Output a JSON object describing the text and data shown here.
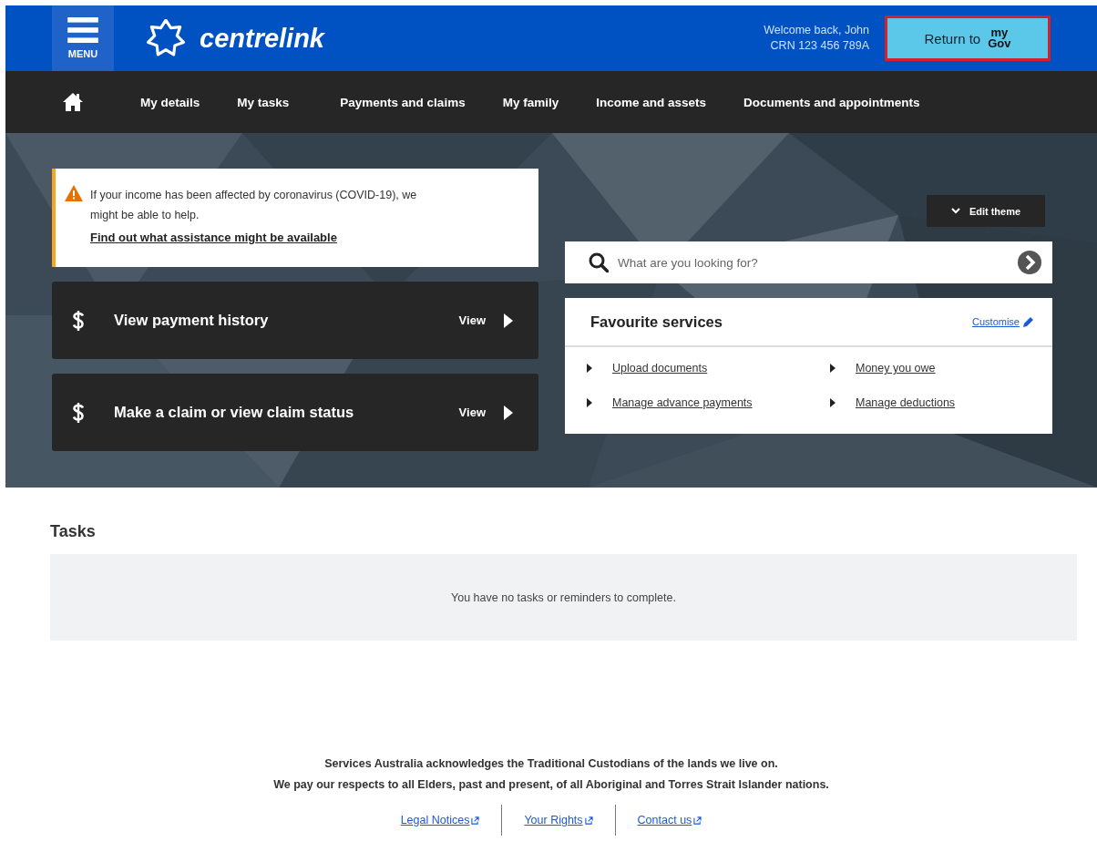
{
  "header": {
    "menu_label": "MENU",
    "brand": "centrelink",
    "welcome": "Welcome back, John",
    "crn": "CRN 123 456 789A",
    "return_button": {
      "label": "Return to",
      "logo": [
        "my",
        "Gov"
      ]
    }
  },
  "nav": {
    "items": [
      "My details",
      "My tasks",
      "Payments and claims",
      "My family",
      "Income and assets",
      "Documents and appointments"
    ]
  },
  "alert": {
    "message": "If your income has been affected by coronavirus (COVID-19), we might be able to help.",
    "link": "Find out what assistance might be available"
  },
  "action_cards": [
    {
      "title": "View payment history",
      "action": "View"
    },
    {
      "title": "Make a claim or view claim status",
      "action": "View"
    }
  ],
  "edit_theme": {
    "label": "Edit theme"
  },
  "search": {
    "placeholder": "What are you looking for?"
  },
  "favourites": {
    "title": "Favourite services",
    "customise": "Customise",
    "items": [
      "Upload documents",
      "Money you owe",
      "Manage advance payments",
      "Manage deductions"
    ]
  },
  "tasks": {
    "heading": "Tasks",
    "empty_message": "You have no tasks or reminders to complete."
  },
  "footer": {
    "acknowledgement": [
      "Services Australia acknowledges the Traditional Custodians of the lands we live on.",
      "We pay our respects to all Elders, past and present, of all Aboriginal and Torres Strait Islander nations."
    ],
    "links": [
      "Legal Notices",
      "Your Rights",
      "Contact us"
    ]
  }
}
